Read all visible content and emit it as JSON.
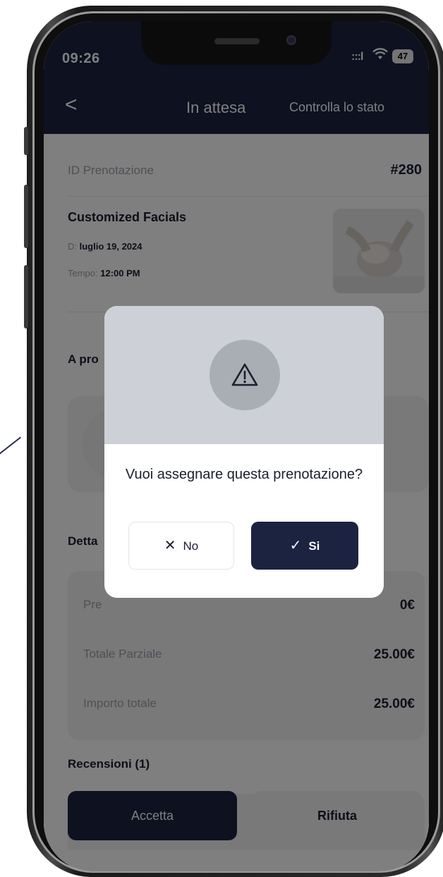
{
  "status_bar": {
    "time": "09:26",
    "signal": ":::l",
    "battery": "47"
  },
  "header": {
    "back": "<",
    "title": "In attesa",
    "action": "Controlla lo stato"
  },
  "booking": {
    "id_label": "ID Prenotazione",
    "id_value": "#280",
    "service_name": "Customized Facials",
    "date_label": "D:",
    "date_value": "luglio 19, 2024",
    "time_label": "Tempo:",
    "time_value": "12:00 PM"
  },
  "sections": {
    "about": "A pro",
    "details": "Detta",
    "reviews": "Recensioni (1)"
  },
  "details_rows": [
    {
      "label": "Pre",
      "value": "0€"
    },
    {
      "label": "Totale Parziale",
      "value": "25.00€"
    },
    {
      "label": "Importo totale",
      "value": "25.00€"
    }
  ],
  "bottom_actions": {
    "accept": "Accetta",
    "reject": "Rifiuta"
  },
  "dialog": {
    "icon": "warning-icon",
    "message": "Vuoi assegnare questa prenotazione?",
    "no_label": "No",
    "yes_label": "Si"
  },
  "colors": {
    "primary": "#1b2340",
    "muted_text": "#9aa0a8",
    "dialog_header": "#cdd0d6"
  }
}
